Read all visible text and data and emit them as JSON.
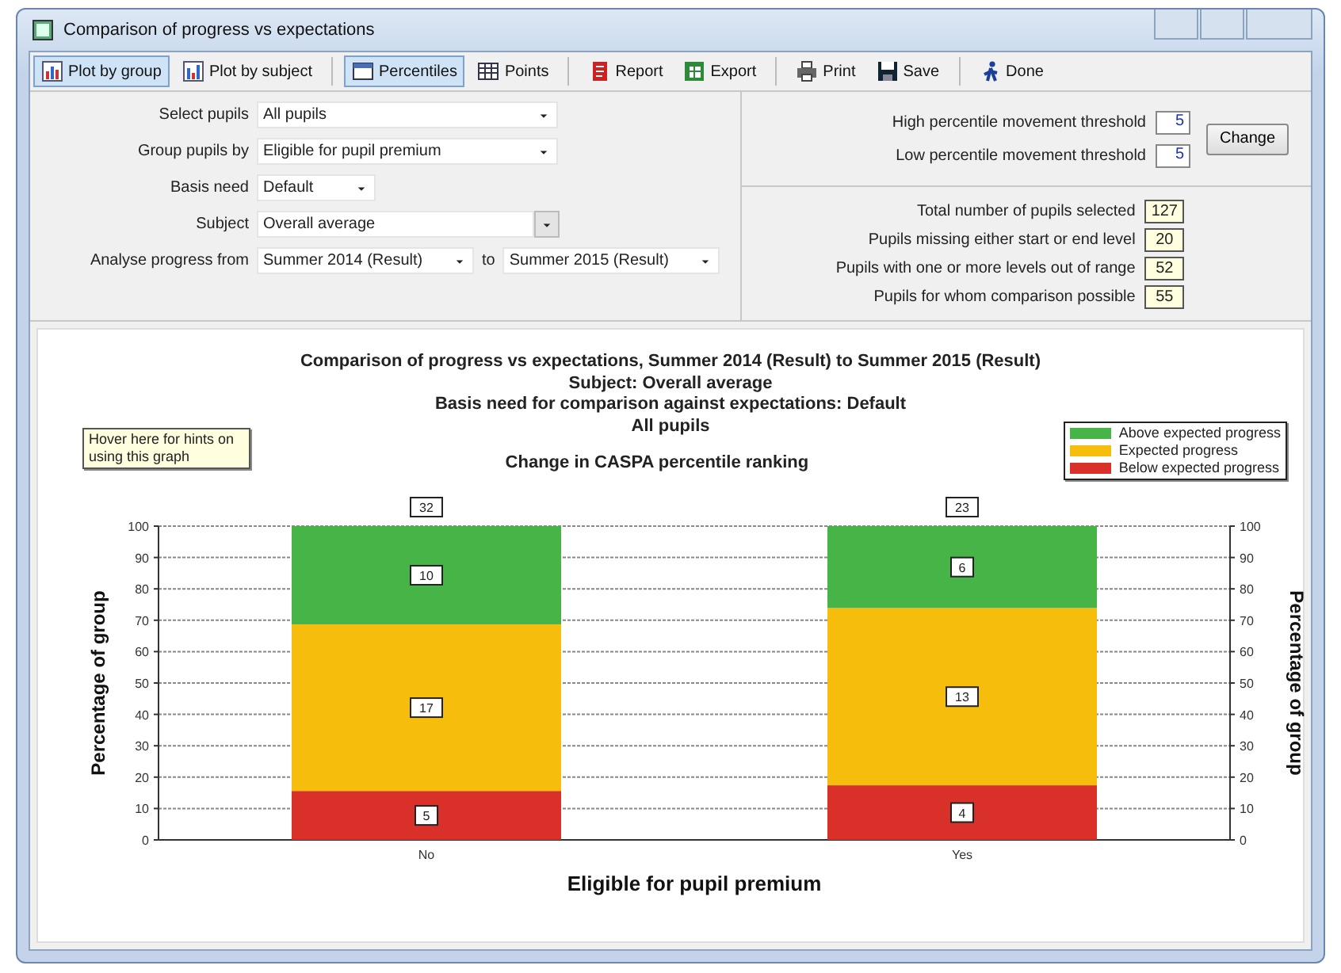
{
  "window": {
    "title": "Comparison of progress vs expectations"
  },
  "toolbar": [
    [
      {
        "label": "Plot by group",
        "selected": true
      },
      {
        "label": "Plot by subject",
        "selected": false
      }
    ],
    [
      {
        "label": "Percentiles",
        "selected": true
      },
      {
        "label": "Points",
        "selected": false
      }
    ],
    [
      {
        "label": "Report",
        "selected": false
      },
      {
        "label": "Export",
        "selected": false
      }
    ],
    [
      {
        "label": "Print",
        "selected": false
      },
      {
        "label": "Save",
        "selected": false
      }
    ],
    [
      {
        "label": "Done",
        "selected": false
      }
    ]
  ],
  "options": [
    {
      "label": "Select pupils",
      "fields": [
        {
          "kind": "dropdown",
          "value": "All pupils"
        }
      ]
    },
    {
      "label": "Group pupils by",
      "fields": [
        {
          "kind": "dropdown",
          "value": "Eligible for pupil premium"
        }
      ]
    },
    {
      "label": "Basis need",
      "fields": [
        {
          "kind": "short-dropdown",
          "value": "Default"
        }
      ]
    },
    {
      "label": "Subject",
      "fields": [
        {
          "kind": "picker",
          "value": "Overall average"
        }
      ]
    },
    {
      "label": "Analyse progress from",
      "joiner": "to",
      "fields": [
        {
          "kind": "half-dropdown",
          "value": "Summer 2014 (Result)"
        },
        {
          "kind": "half-dropdown",
          "value": "Summer 2015 (Result)"
        }
      ]
    }
  ],
  "thresholds": [
    {
      "label": "High percentile movement threshold",
      "value": "5"
    },
    {
      "label": "Low percentile movement threshold",
      "value": "5"
    }
  ],
  "change_button": "Change",
  "stats": [
    {
      "label": "Total number of pupils selected",
      "value": "127"
    },
    {
      "label": "Pupils missing either start or end level",
      "value": "20"
    },
    {
      "label": "Pupils with one or more levels out of range",
      "value": "52"
    },
    {
      "label": "Pupils for whom comparison possible",
      "value": "55"
    }
  ],
  "report": {
    "headings": [
      "Comparison of progress vs expectations, Summer 2014 (Result) to Summer 2015 (Result)",
      "Subject: Overall average",
      "Basis need for comparison against expectations: Default",
      "All pupils"
    ],
    "hint": "Hover here for hints on using this graph",
    "bar_totals": [
      "32",
      "23"
    ],
    "segment_counts": [
      [
        "10",
        "6"
      ],
      [
        "17",
        "13"
      ],
      [
        "5",
        "4"
      ]
    ],
    "chart_data": {
      "type": "bar",
      "stacked": true,
      "grid": true,
      "y2lim": [
        0,
        100
      ],
      "y2ticks": [
        0,
        10,
        20,
        30,
        40,
        50,
        60,
        70,
        80,
        90,
        100
      ],
      "title": "Change in CASPA percentile ranking",
      "xlabel": "Eligible for pupil premium",
      "ylabel": "Percentage of group",
      "y2label": "Percentage of group",
      "categories": [
        "No",
        "Yes"
      ],
      "ylim": [
        0,
        100
      ],
      "yticks": [
        0,
        10,
        20,
        30,
        40,
        50,
        60,
        70,
        80,
        90,
        100
      ],
      "series": [
        {
          "name": "Above expected progress",
          "color": "#46b446",
          "values": [
            31.3,
            26.1
          ]
        },
        {
          "name": "Expected progress",
          "color": "#f7bd0c",
          "values": [
            53.1,
            56.5
          ]
        },
        {
          "name": "Below expected progress",
          "color": "#d9302a",
          "values": [
            15.6,
            17.4
          ]
        }
      ]
    }
  }
}
